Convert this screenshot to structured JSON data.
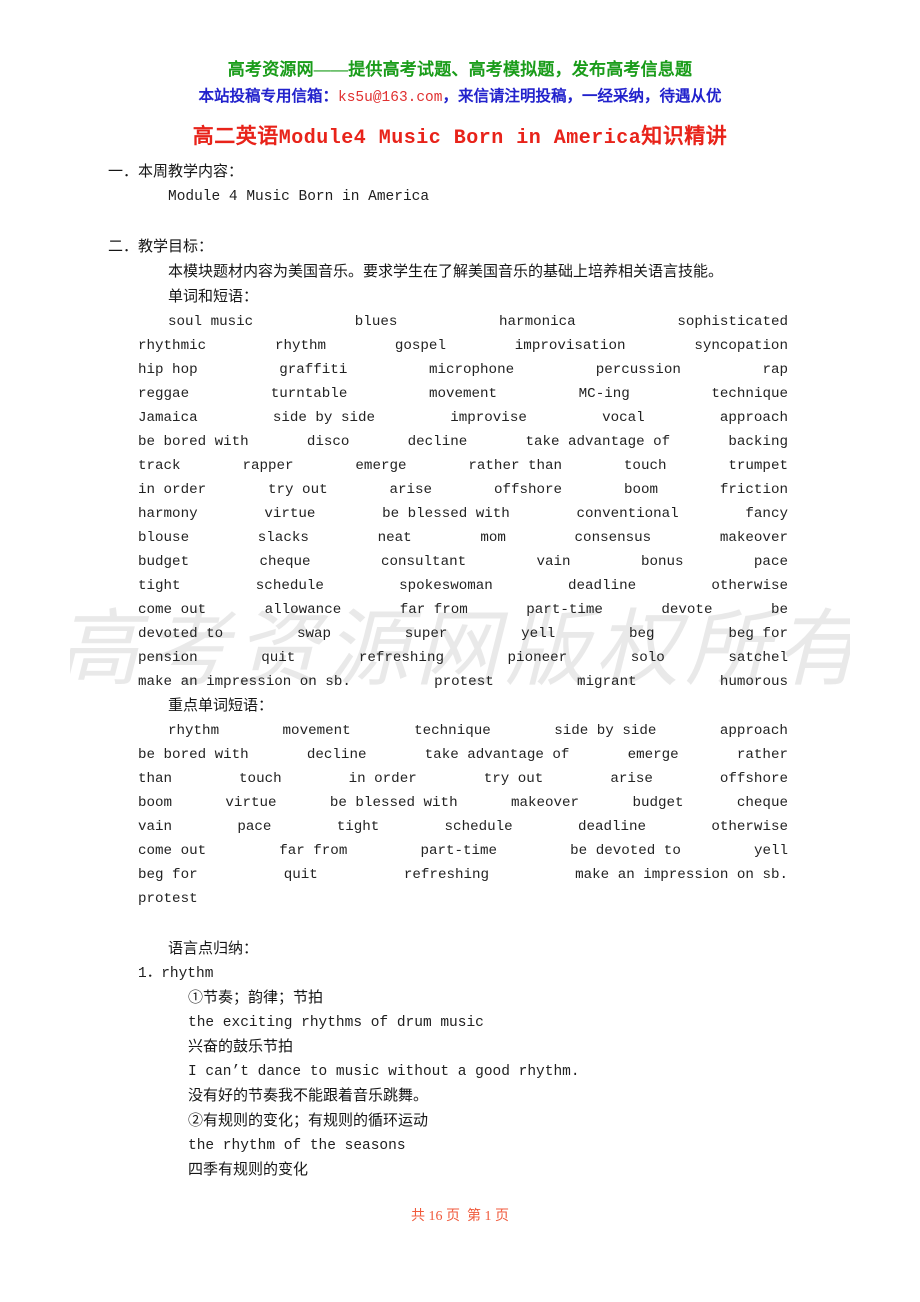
{
  "banner": {
    "line1": "高考资源网——提供高考试题、高考模拟题，发布高考信息题",
    "line2_pre": "本站投稿专用信箱：",
    "line2_email": "ks5u@163.com",
    "line2_post": "，来信请注明投稿，一经采纳，待遇从优",
    "color_line1": "#1a9c1a",
    "color_line2": "#2222cc",
    "color_email": "#e03030"
  },
  "title": {
    "cn_prefix": "高二英语",
    "latin": "Module4 Music Born in America",
    "cn_suffix": "知识精讲",
    "color": "#e8231a"
  },
  "section_one": {
    "heading": "一．本周教学内容：",
    "body": "Module 4 Music Born in America"
  },
  "section_two": {
    "heading": "二．教学目标：",
    "intro": "本模块题材内容为美国音乐。要求学生在了解美国音乐的基础上培养相关语言技能。",
    "vocab_label": "单词和短语：",
    "vocab_rows": [
      [
        "soul music",
        "blues",
        "harmonica",
        "sophisticated"
      ],
      [
        "rhythmic",
        "rhythm",
        "gospel",
        "improvisation",
        "syncopation"
      ],
      [
        "hip hop",
        "graffiti",
        "microphone",
        "percussion",
        "rap"
      ],
      [
        "reggae",
        "turntable",
        "movement",
        "MC-ing",
        "technique"
      ],
      [
        "Jamaica",
        "side by side",
        "improvise",
        "vocal",
        "approach"
      ],
      [
        "be bored with",
        "disco",
        "decline",
        "take advantage of",
        "backing"
      ],
      [
        "track",
        "rapper",
        "emerge",
        "rather than",
        "touch",
        "trumpet"
      ],
      [
        "in order",
        "try out",
        "arise",
        "offshore",
        "boom",
        "friction"
      ],
      [
        "harmony",
        "virtue",
        "be blessed with",
        "conventional",
        "fancy"
      ],
      [
        "blouse",
        "slacks",
        "neat",
        "mom",
        "consensus",
        "makeover"
      ],
      [
        "budget",
        "cheque",
        "consultant",
        "vain",
        "bonus",
        "pace"
      ],
      [
        "tight",
        "schedule",
        "spokeswoman",
        "deadline",
        "otherwise"
      ],
      [
        "come out",
        "allowance",
        "far from",
        "part-time",
        "devote",
        "be"
      ],
      [
        "devoted to",
        "swap",
        "super",
        "yell",
        "beg",
        "beg for"
      ],
      [
        "pension",
        "quit",
        "refreshing",
        "pioneer",
        "solo",
        "satchel"
      ],
      [
        "make an impression on sb.",
        "protest",
        "migrant",
        "humorous"
      ]
    ],
    "key_vocab_label": "重点单词短语：",
    "key_vocab_rows": [
      [
        "rhythm",
        "movement",
        "technique",
        "side by side",
        "approach"
      ],
      [
        "be bored with",
        "decline",
        "take advantage of",
        "emerge",
        "rather"
      ],
      [
        "than",
        "touch",
        "in order",
        "try out",
        "arise",
        "offshore"
      ],
      [
        "boom",
        "virtue",
        "be blessed with",
        "makeover",
        "budget",
        "cheque"
      ],
      [
        "vain",
        "pace",
        "tight",
        "schedule",
        "deadline",
        "otherwise"
      ],
      [
        "come out",
        "far from",
        "part-time",
        "be devoted to",
        "yell"
      ],
      [
        "beg for",
        "quit",
        "refreshing",
        "make an impression on sb."
      ],
      [
        "protest"
      ]
    ]
  },
  "language_points": {
    "label": "语言点归纳：",
    "items": [
      {
        "number": "1．rhythm",
        "lines": [
          {
            "type": "cn",
            "text": "①节奏；韵律；节拍"
          },
          {
            "type": "en",
            "text": "the exciting rhythms of drum music"
          },
          {
            "type": "cn",
            "text": "兴奋的鼓乐节拍"
          },
          {
            "type": "en",
            "text": "I can’t dance to music without a good rhythm."
          },
          {
            "type": "cn",
            "text": "没有好的节奏我不能跟着音乐跳舞。"
          },
          {
            "type": "cn",
            "text": "②有规则的变化；有规则的循环运动"
          },
          {
            "type": "en",
            "text": "the rhythm of the seasons"
          },
          {
            "type": "cn",
            "text": "四季有规则的变化"
          }
        ]
      }
    ]
  },
  "watermark": {
    "text": "高考资源网版权所有"
  },
  "footer": {
    "text": "共 16 页  第 1 页",
    "color": "#f05a3c"
  }
}
